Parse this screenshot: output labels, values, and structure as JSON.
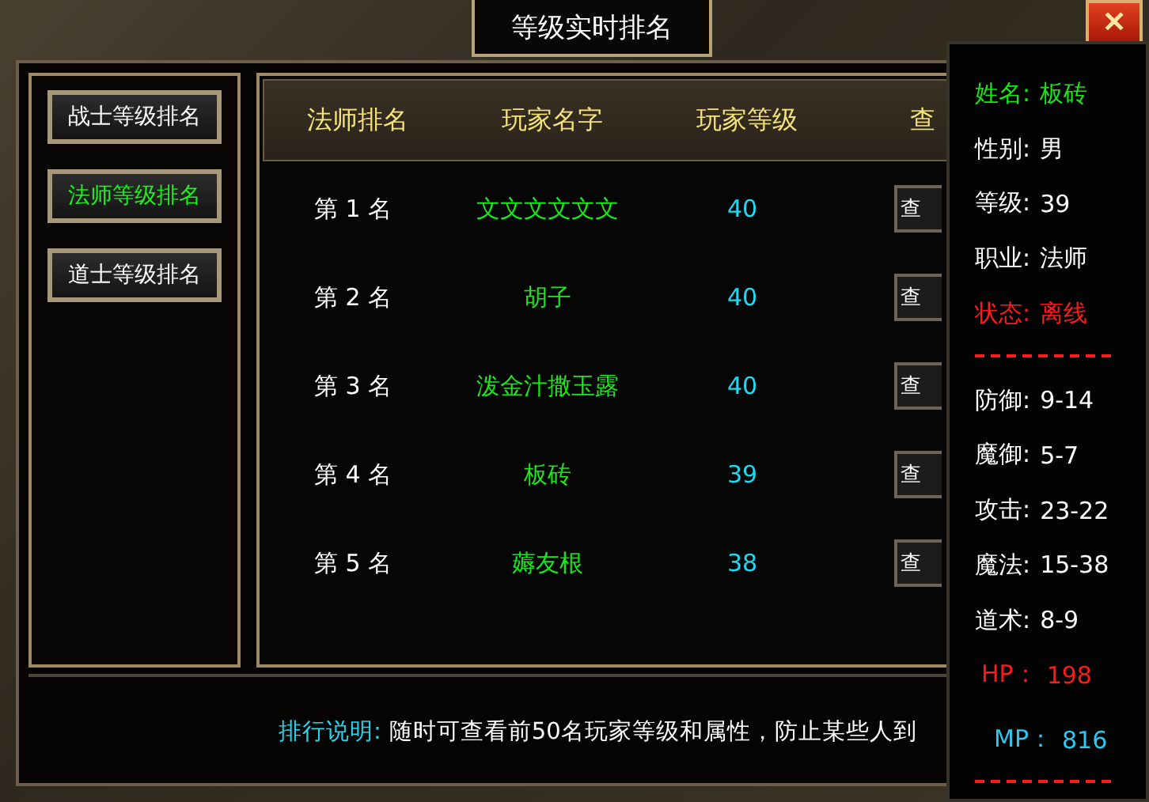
{
  "window": {
    "title": "等级实时排名",
    "close": "✕"
  },
  "sidebar": {
    "items": [
      {
        "label": "战士等级排名",
        "selected": false
      },
      {
        "label": "法师等级排名",
        "selected": true
      },
      {
        "label": "道士等级排名",
        "selected": false
      }
    ]
  },
  "table": {
    "columns": [
      "法师排名",
      "玩家名字",
      "玩家等级",
      "查"
    ],
    "rows": [
      {
        "rank": "第 1 名",
        "name": "文文文文文文",
        "level": "40",
        "action": "查"
      },
      {
        "rank": "第 2 名",
        "name": "胡子",
        "level": "40",
        "action": "查"
      },
      {
        "rank": "第 3 名",
        "name": "泼金汁撒玉露",
        "level": "40",
        "action": "查"
      },
      {
        "rank": "第 4 名",
        "name": "板砖",
        "level": "39",
        "action": "查"
      },
      {
        "rank": "第 5 名",
        "name": "薅友根",
        "level": "38",
        "action": "查"
      }
    ]
  },
  "note": {
    "label": "排行说明:",
    "text": "随时可查看前50名玩家等级和属性，防止某些人到"
  },
  "player_popup": {
    "lines": [
      {
        "kind": "name",
        "label": "姓名:",
        "value": "板砖"
      },
      {
        "kind": "plain",
        "label": "性别:",
        "value": "男"
      },
      {
        "kind": "plain",
        "label": "等级:",
        "value": "39"
      },
      {
        "kind": "plain",
        "label": "职业:",
        "value": "法师"
      },
      {
        "kind": "status",
        "label": "状态:",
        "value": "离线"
      },
      {
        "kind": "divider"
      },
      {
        "kind": "plain",
        "label": "防御:",
        "value": "9-14"
      },
      {
        "kind": "plain",
        "label": "魔御:",
        "value": "5-7"
      },
      {
        "kind": "plain",
        "label": "攻击:",
        "value": "23-22"
      },
      {
        "kind": "plain",
        "label": "魔法:",
        "value": "15-38"
      },
      {
        "kind": "plain",
        "label": "道术:",
        "value": "8-9"
      },
      {
        "kind": "hp",
        "label": "HP：",
        "value": "198"
      },
      {
        "kind": "mp",
        "label": "MP：",
        "value": "816"
      },
      {
        "kind": "divider"
      }
    ]
  }
}
